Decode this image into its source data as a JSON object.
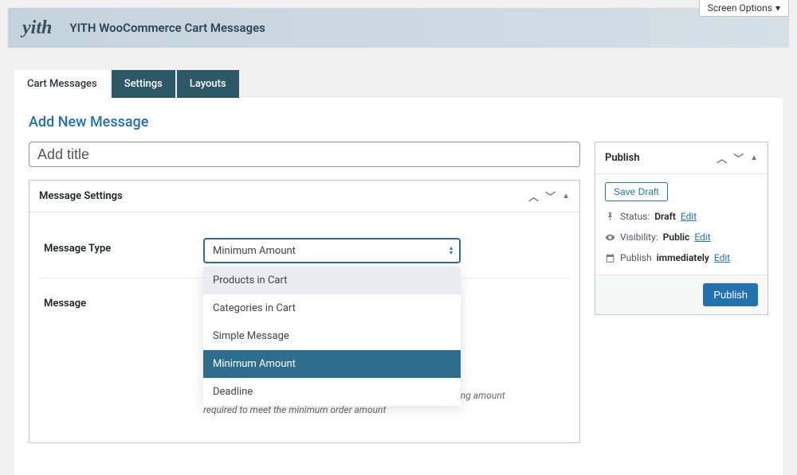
{
  "screen_options": "Screen Options",
  "logo_text": "yith",
  "header_title": "YITH WooCommerce Cart Messages",
  "tabs": {
    "cart_messages": "Cart Messages",
    "settings": "Settings",
    "layouts": "Layouts"
  },
  "page_title": "Add New Message",
  "title_placeholder": "Add title",
  "message_settings": {
    "box_title": "Message Settings",
    "type_label": "Message Type",
    "type_value": "Minimum Amount",
    "type_options": {
      "products": "Products in Cart",
      "categories": "Categories in Cart",
      "simple": "Simple Message",
      "minimum": "Minimum Amount",
      "deadline": "Deadline"
    },
    "message_label": "Message",
    "help_text": "Edit the message. You can use {remaining_amount} as remaining amount required to meet the minimum order amount"
  },
  "publish": {
    "box_title": "Publish",
    "save_draft": "Save Draft",
    "status_label": "Status:",
    "status_value": "Draft",
    "visibility_label": "Visibility:",
    "visibility_value": "Public",
    "publish_label": "Publish",
    "publish_value": "immediately",
    "edit": "Edit",
    "publish_btn": "Publish"
  }
}
